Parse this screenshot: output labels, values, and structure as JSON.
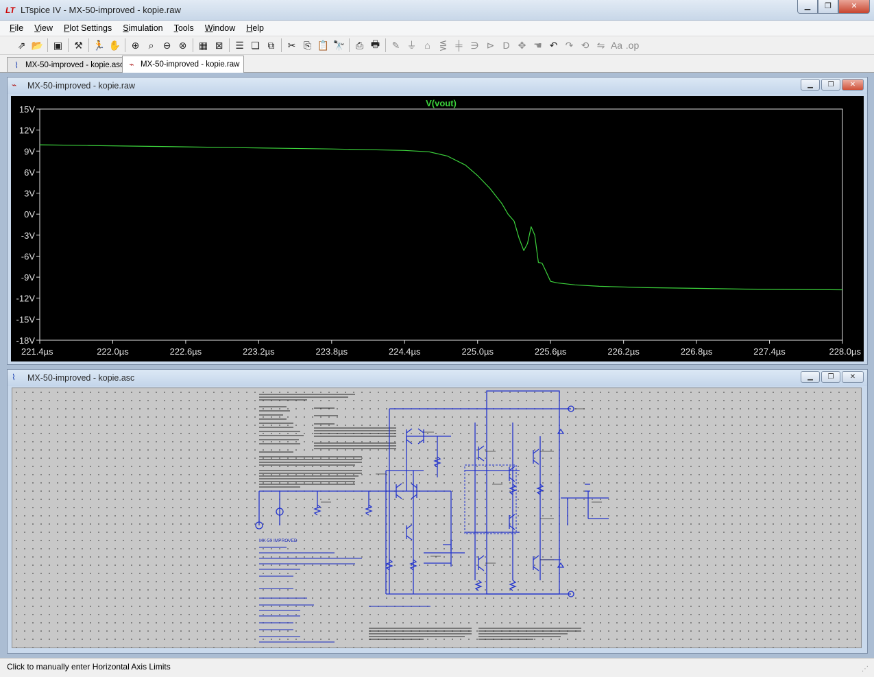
{
  "window": {
    "title": "LTspice IV - MX-50-improved - kopie.raw",
    "icon": "ltspice-logo-icon"
  },
  "menu": [
    {
      "label": "File",
      "ul": "F",
      "rest": "ile"
    },
    {
      "label": "View",
      "ul": "V",
      "rest": "iew"
    },
    {
      "label": "Plot Settings",
      "ul": "P",
      "rest": "lot Settings"
    },
    {
      "label": "Simulation",
      "ul": "S",
      "rest": "imulation"
    },
    {
      "label": "Tools",
      "ul": "T",
      "rest": "ools"
    },
    {
      "label": "Window",
      "ul": "W",
      "rest": "indow"
    },
    {
      "label": "Help",
      "ul": "H",
      "rest": "elp"
    }
  ],
  "toolbar": {
    "icons": [
      "open-icon",
      "folder-icon",
      "save-icon",
      "control-panel-icon",
      "run-icon",
      "halt-icon",
      "zoom-in-icon",
      "zoom-area-icon",
      "zoom-out-icon",
      "zoom-cancel-icon",
      "autorange-icon",
      "delete-trace-icon",
      "tile-horizontal-icon",
      "cascade-icon",
      "tile-vertical-icon",
      "cut-icon",
      "copy-icon",
      "paste-icon",
      "find-icon",
      "print-preview-icon",
      "print-icon",
      "wire-icon",
      "ground-icon",
      "label-icon",
      "resistor-icon",
      "capacitor-icon",
      "inductor-icon",
      "diode-icon",
      "component-icon",
      "move-icon",
      "drag-icon",
      "undo-icon",
      "redo-icon",
      "rotate-icon",
      "mirror-icon",
      "text-icon",
      "spice-directive-icon"
    ]
  },
  "tabs": [
    {
      "label": "MX-50-improved - kopie.asc",
      "icon": "schematic-icon",
      "active": false
    },
    {
      "label": "MX-50-improved - kopie.raw",
      "icon": "waveform-icon",
      "active": true
    }
  ],
  "waveform_window": {
    "title": "MX-50-improved - kopie.raw",
    "trace_label": "V(vout)",
    "trace_color": "#3cd33c"
  },
  "schematic_window": {
    "title": "MX-50-improved - kopie.asc",
    "annotations": [
      "MX-50 IMPROVED"
    ]
  },
  "chart_data": {
    "type": "line",
    "title": "",
    "xlabel": "",
    "ylabel": "",
    "xlim": [
      221.4,
      228.0
    ],
    "ylim": [
      -18,
      15
    ],
    "x_ticks": [
      "221.4µs",
      "222.0µs",
      "222.6µs",
      "223.2µs",
      "223.8µs",
      "224.4µs",
      "225.0µs",
      "225.6µs",
      "226.2µs",
      "226.8µs",
      "227.4µs",
      "228.0µs"
    ],
    "x_tick_values": [
      221.4,
      222.0,
      222.6,
      223.2,
      223.8,
      224.4,
      225.0,
      225.6,
      226.2,
      226.8,
      227.4,
      228.0
    ],
    "y_ticks": [
      "15V",
      "12V",
      "9V",
      "6V",
      "3V",
      "0V",
      "-3V",
      "-6V",
      "-9V",
      "-12V",
      "-15V",
      "-18V"
    ],
    "y_tick_values": [
      15,
      12,
      9,
      6,
      3,
      0,
      -3,
      -6,
      -9,
      -12,
      -15,
      -18
    ],
    "series": [
      {
        "name": "V(vout)",
        "color": "#3cd33c",
        "x": [
          221.4,
          221.8,
          222.2,
          222.6,
          223.0,
          223.4,
          223.8,
          224.1,
          224.4,
          224.6,
          224.75,
          224.9,
          225.0,
          225.1,
          225.2,
          225.25,
          225.3,
          225.34,
          225.38,
          225.41,
          225.44,
          225.47,
          225.5,
          225.53,
          225.56,
          225.6,
          225.65,
          225.7,
          225.8,
          226.0,
          226.4,
          226.8,
          227.2,
          227.6,
          228.0
        ],
        "y": [
          9.9,
          9.8,
          9.7,
          9.6,
          9.5,
          9.4,
          9.3,
          9.2,
          9.1,
          8.9,
          8.3,
          7.0,
          5.5,
          3.7,
          1.5,
          0.0,
          -1.0,
          -3.4,
          -5.2,
          -4.2,
          -1.8,
          -3.0,
          -6.9,
          -7.0,
          -8.1,
          -9.6,
          -9.8,
          -9.9,
          -10.1,
          -10.3,
          -10.5,
          -10.6,
          -10.7,
          -10.75,
          -10.8
        ]
      }
    ],
    "grid": false,
    "background": "#000000",
    "axis_color": "#e0e0e0"
  },
  "status": {
    "text": "Click to manually enter Horizontal Axis Limits"
  }
}
